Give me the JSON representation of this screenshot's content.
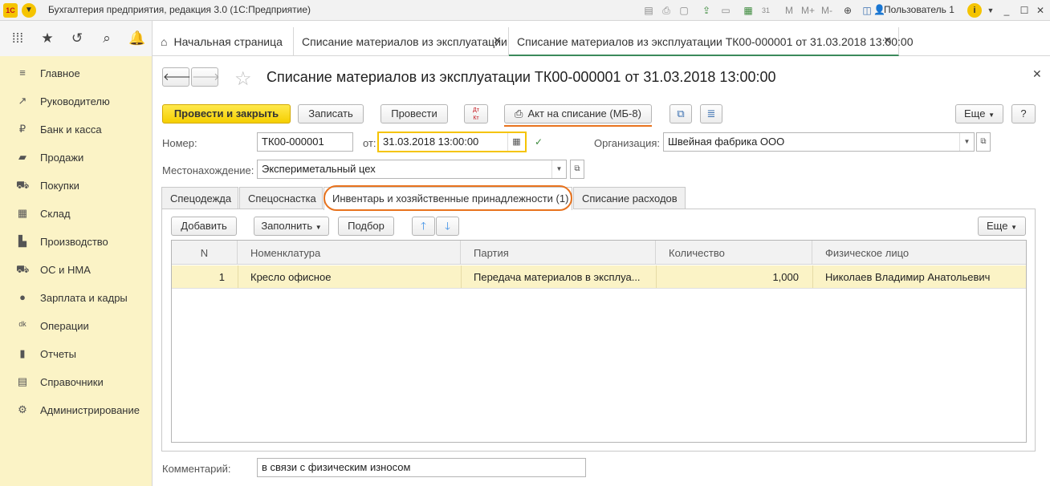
{
  "app": {
    "logo": "1С",
    "title": "Бухгалтерия предприятия, редакция 3.0  (1С:Предприятие)",
    "user": "Пользователь 1",
    "toolbar_icons": [
      "save-icon",
      "print-icon",
      "preview-icon",
      "upload-icon",
      "clipboard-icon",
      "calculator-icon",
      "calendar-icon",
      "M",
      "M+",
      "M-",
      "zoom-icon",
      "panel-icon"
    ],
    "m": "M",
    "mplus": "M+",
    "mminus": "M-"
  },
  "tabs": [
    {
      "label": "Начальная страница"
    },
    {
      "label": "Списание материалов из эксплуатации"
    },
    {
      "label": "Списание материалов из эксплуатации ТК00-000001 от 31.03.2018 13:00:00"
    }
  ],
  "sidebar": {
    "items": [
      {
        "label": "Главное",
        "icon": "menu-icon"
      },
      {
        "label": "Руководителю",
        "icon": "trend-icon"
      },
      {
        "label": "Банк и касса",
        "icon": "ruble-icon"
      },
      {
        "label": "Продажи",
        "icon": "bag-icon"
      },
      {
        "label": "Покупки",
        "icon": "cart-icon"
      },
      {
        "label": "Склад",
        "icon": "warehouse-icon"
      },
      {
        "label": "Производство",
        "icon": "factory-icon"
      },
      {
        "label": "ОС и НМА",
        "icon": "truck-icon"
      },
      {
        "label": "Зарплата и кадры",
        "icon": "person-icon"
      },
      {
        "label": "Операции",
        "icon": "dt-kt-icon"
      },
      {
        "label": "Отчеты",
        "icon": "bar-chart-icon"
      },
      {
        "label": "Справочники",
        "icon": "book-icon"
      },
      {
        "label": "Администрирование",
        "icon": "gear-icon"
      }
    ]
  },
  "doc": {
    "title": "Списание материалов из эксплуатации ТК00-000001 от 31.03.2018 13:00:00"
  },
  "toolbar": {
    "post_close": "Провести и закрыть",
    "write": "Записать",
    "post": "Провести",
    "dtkt": "Дт Кт",
    "act": "Акт на списание (МБ-8)",
    "more": "Еще",
    "help": "?"
  },
  "form": {
    "number_label": "Номер:",
    "number": "ТК00-000001",
    "date_label": "от:",
    "date": "31.03.2018 13:00:00",
    "org_label": "Организация:",
    "org": "Швейная фабрика ООО",
    "location_label": "Местонахождение:",
    "location": "Экспериметальный цех",
    "comment_label": "Комментарий:",
    "comment": "в связи с физическим износом"
  },
  "ftabs": [
    "Спецодежда",
    "Спецоснастка",
    "Инвентарь и хозяйственные принадлежности (1)",
    "Списание расходов"
  ],
  "grid_toolbar": {
    "add": "Добавить",
    "fill": "Заполнить",
    "select": "Подбор",
    "more": "Еще"
  },
  "table": {
    "columns": [
      "N",
      "Номенклатура",
      "Партия",
      "Количество",
      "Физическое лицо"
    ],
    "rows": [
      {
        "n": "1",
        "item": "Кресло офисное",
        "batch": "Передача материалов в эксплуа...",
        "qty": "1,000",
        "person": "Николаев Владимир Анатольевич"
      }
    ]
  }
}
